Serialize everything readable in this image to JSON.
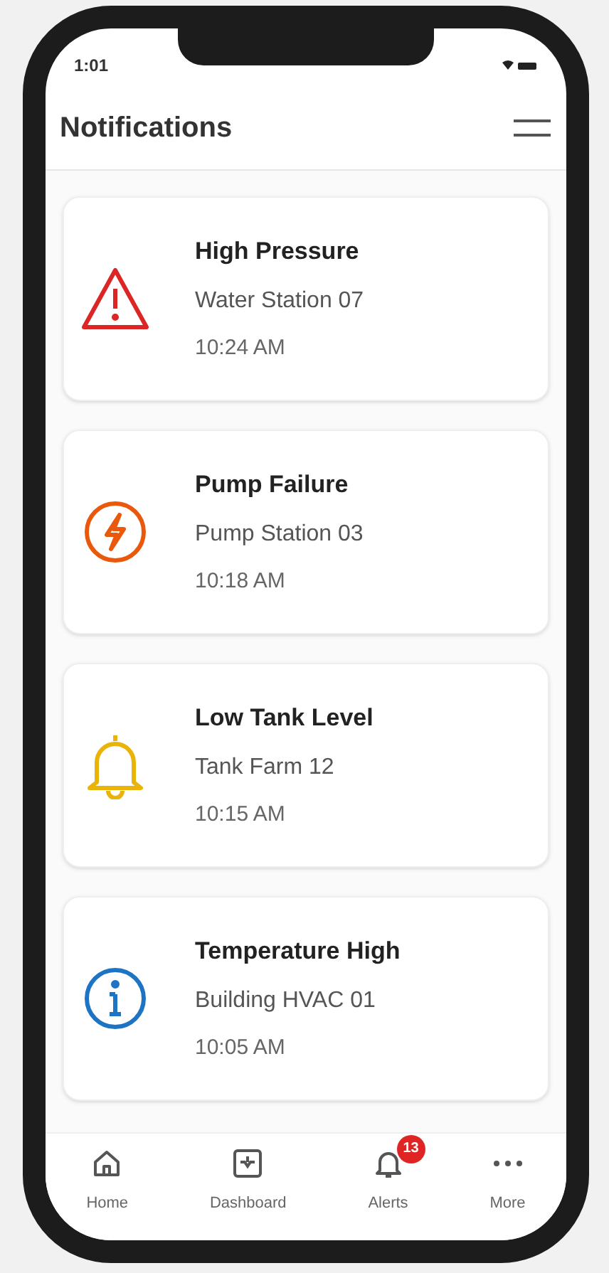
{
  "status_bar": {
    "time": "1:01"
  },
  "header": {
    "title": "Notifications"
  },
  "notifications": [
    {
      "kind": "warning",
      "color": "#dc2626",
      "title": "High Pressure",
      "source": "Water Station 07",
      "time": "10:24 AM"
    },
    {
      "kind": "power",
      "color": "#ea580c",
      "title": "Pump Failure",
      "source": "Pump Station 03",
      "time": "10:18 AM"
    },
    {
      "kind": "bell",
      "color": "#eab308",
      "title": "Low Tank Level",
      "source": "Tank Farm 12",
      "time": "10:15 AM"
    },
    {
      "kind": "info",
      "color": "#1d74c4",
      "title": "Temperature High",
      "source": "Building HVAC 01",
      "time": "10:05 AM"
    }
  ],
  "nav": [
    {
      "kind": "home",
      "label": "Home"
    },
    {
      "kind": "dashboard",
      "label": "Dashboard"
    },
    {
      "kind": "alerts",
      "label": "Alerts",
      "badge": "13"
    },
    {
      "kind": "more",
      "label": "More"
    }
  ]
}
